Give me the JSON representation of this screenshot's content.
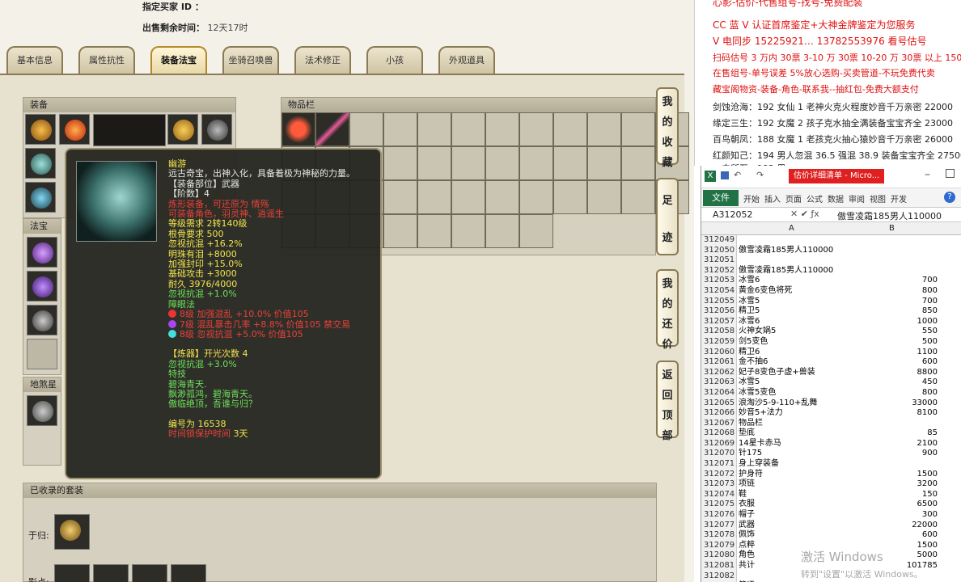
{
  "game": {
    "buyer_label": "指定买家 ID ：",
    "sale_time_label": "出售剩余时间：",
    "sale_time_value": "12天17时",
    "tabs": [
      "基本信息",
      "属性抗性",
      "装备法宝",
      "坐骑召唤兽",
      "法术修正",
      "小孩",
      "外观道具"
    ],
    "active_tab": "装备法宝",
    "panels": {
      "equipment": "装备",
      "items": "物品栏",
      "treasure": "法宝",
      "star": "地煞星",
      "collected_sets": "已收录的套装",
      "return_label": "于归:",
      "shadow_label": "影点:"
    },
    "side_buttons": [
      {
        "label": "我的收藏"
      },
      {
        "label": "足迹"
      },
      {
        "label": "我的还价"
      },
      {
        "label": "返回顶部"
      }
    ],
    "tooltip": {
      "name": "幽游",
      "desc": "远古奇宝，出神入化，具备着极为神秘的力量。",
      "slot": "【装备部位】武器",
      "rank": "【阶数】4",
      "refine1": "炼形装备，可还原为 情殇",
      "refine2": "可装备角色，羽灵神、逍遥生",
      "level": "等级需求 2转140级",
      "root": "根骨要求 500",
      "stat1": "忽视抗混 +16.2%",
      "stat2": "明珠有泪 +8000",
      "stat3": "加强封印 +15.0%",
      "stat4": "基础攻击 +3000",
      "durability": "耐久 3976/4000",
      "stat5": "忽视抗混 +1.0%",
      "gem_header": "障眼法",
      "gem1": "8级 加强混乱 +10.0% 价值105",
      "gem2": "7级 混乱暴击几率 +8.8% 价值105 禁交易",
      "gem3": "8级 忽视抗混 +5.0% 价值105",
      "refiner": "【炼器】开光次数 4",
      "refiner_stat": "忽视抗混 +3.0%",
      "skill_header": "特技",
      "poem1": "碧海青天.",
      "poem2": "飘渺孤鸿，碧海青天。",
      "poem3": "傲临绝顶，吾谁与归？",
      "serial": "编号为 16538",
      "protect_label": "时间锁保护时间",
      "protect_value": "3天"
    }
  },
  "right_panel": {
    "lines": [
      "心影-估价-代售组号-找号-免费配装",
      "CC 蓝 V 认证首席鉴定+大神金牌鉴定为您服务",
      "V 电同步 15225921… 13782553976 看号估号",
      "扫码估号 3 万内 30票 3-10 万 30票 10-20 万 30票 以上 150",
      "在售组号-单号误差 5%放心选购-买卖管道-不玩免费代卖",
      "藏宝阁物资-装备-角色-联系我--抽红包-免费大额支付",
      "剑蚀沧海：192 女仙 1 老神火克火程度妙音千万亲密 22000",
      "缘定三生：192 女魔 2 孩子克水抽全满装备宝宝齐全 23000",
      "百鸟朝凤：188 女魔 1 老孩克火抽心猿妙音千万亲密 26000",
      "红颜知己：194 男人忽混 36.5 强混 38.9 装备宝宝齐全 27500",
      "一夫所至：192 男 …"
    ]
  },
  "excel": {
    "window_title": "估价详细清单 - Micro...",
    "file_tab": "文件",
    "ribbon_tabs": [
      "开始",
      "插入",
      "页面",
      "公式",
      "数据",
      "审阅",
      "视图",
      "开发"
    ],
    "name_box": "A312052",
    "formula_bar": "傲雪凌霜185男人110000",
    "col_a": "A",
    "col_b": "B",
    "rows": [
      {
        "n": "312049",
        "a": "",
        "b": ""
      },
      {
        "n": "312050",
        "a": "傲雪凌霜185男人110000",
        "b": ""
      },
      {
        "n": "312051",
        "a": "",
        "b": ""
      },
      {
        "n": "312052",
        "a": "傲雪凌霜185男人110000",
        "b": ""
      },
      {
        "n": "312053",
        "a": "冰雪6",
        "b": "700"
      },
      {
        "n": "312054",
        "a": "黄金6变色将死",
        "b": "800"
      },
      {
        "n": "312055",
        "a": "冰雪5",
        "b": "700"
      },
      {
        "n": "312056",
        "a": "精卫5",
        "b": "850"
      },
      {
        "n": "312057",
        "a": "冰雪6",
        "b": "1000"
      },
      {
        "n": "312058",
        "a": "火神女娲5",
        "b": "550"
      },
      {
        "n": "312059",
        "a": "剑5变色",
        "b": "500"
      },
      {
        "n": "312060",
        "a": "精卫6",
        "b": "1100"
      },
      {
        "n": "312061",
        "a": "金不抽6",
        "b": "600"
      },
      {
        "n": "312062",
        "a": "妃子8变色子虚+兽装",
        "b": "8800"
      },
      {
        "n": "312063",
        "a": "冰雪5",
        "b": "450"
      },
      {
        "n": "312064",
        "a": "冰雪5变色",
        "b": "800"
      },
      {
        "n": "312065",
        "a": "浪淘沙5-9-110+乱舞",
        "b": "33000"
      },
      {
        "n": "312066",
        "a": "妙音5+法力",
        "b": "8100"
      },
      {
        "n": "312067",
        "a": "物品栏",
        "b": ""
      },
      {
        "n": "312068",
        "a": "垫底",
        "b": "85"
      },
      {
        "n": "312069",
        "a": "14星卡赤马",
        "b": "2100"
      },
      {
        "n": "312070",
        "a": "针175",
        "b": "900"
      },
      {
        "n": "312071",
        "a": "身上穿装备",
        "b": ""
      },
      {
        "n": "312072",
        "a": "护身符",
        "b": "1500"
      },
      {
        "n": "312073",
        "a": "项链",
        "b": "3200"
      },
      {
        "n": "312074",
        "a": "鞋",
        "b": "150"
      },
      {
        "n": "312075",
        "a": "衣服",
        "b": "6500"
      },
      {
        "n": "312076",
        "a": "帽子",
        "b": "300"
      },
      {
        "n": "312077",
        "a": "武器",
        "b": "22000"
      },
      {
        "n": "312078",
        "a": "佩饰",
        "b": "600"
      },
      {
        "n": "312079",
        "a": "点粹",
        "b": "1500"
      },
      {
        "n": "312080",
        "a": "角色",
        "b": "5000"
      },
      {
        "n": "312081",
        "a": "共计",
        "b": "101785"
      },
      {
        "n": "312082",
        "a": "",
        "b": ""
      },
      {
        "n": "312083",
        "a": "简评",
        "b": ""
      }
    ]
  },
  "watermark": {
    "line1": "激活 Windows",
    "line2": "转到\"设置\"以激活 Windows。"
  }
}
